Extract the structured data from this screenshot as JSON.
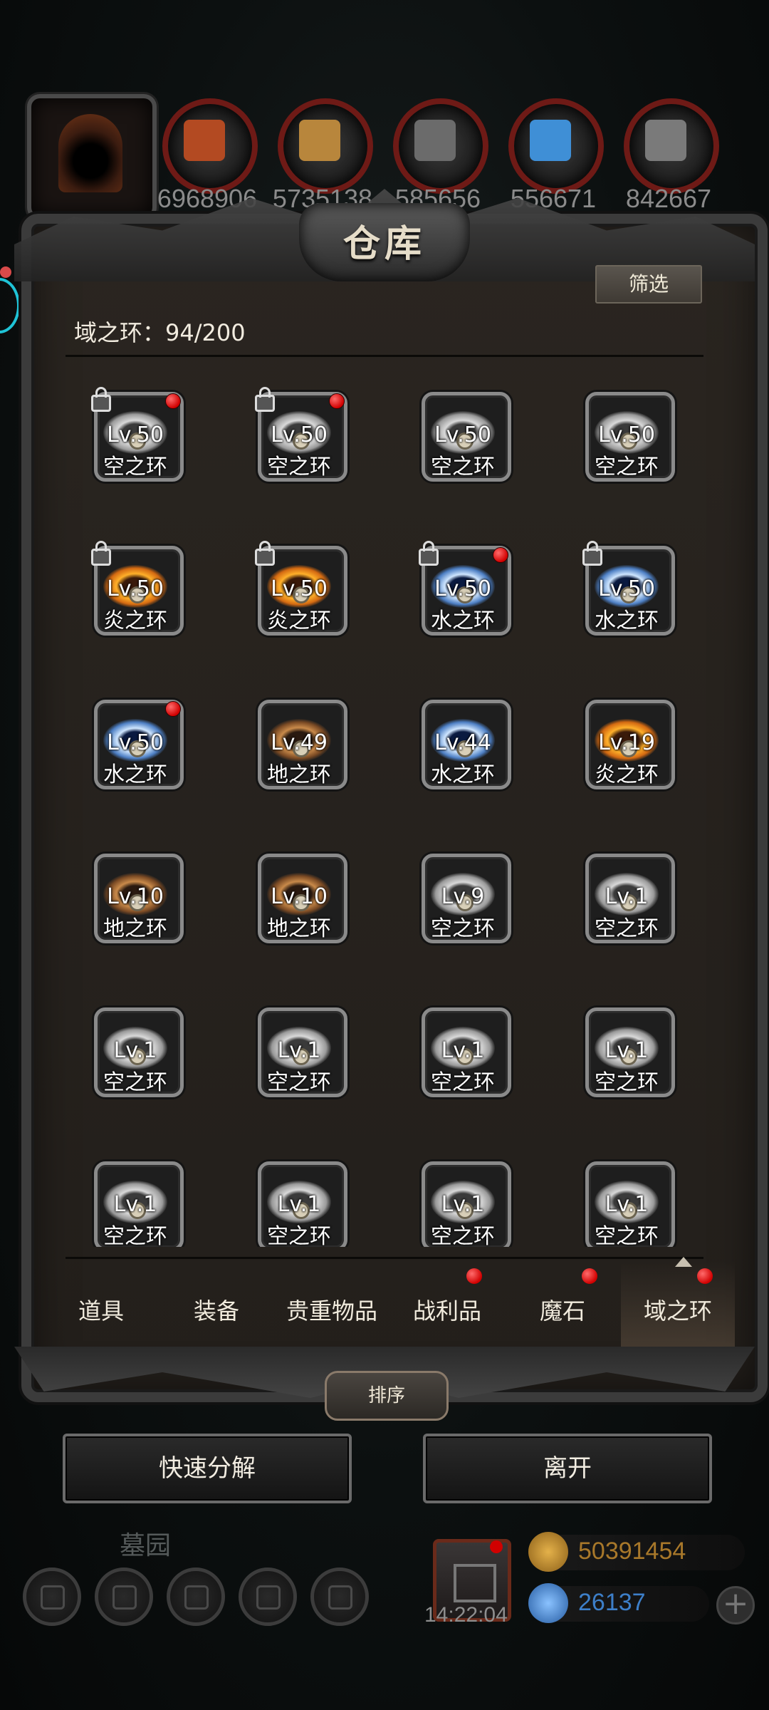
{
  "resources": [
    {
      "value": "6968906",
      "icon": "meat-icon",
      "color": "#b34a22"
    },
    {
      "value": "5735138",
      "icon": "wood-icon",
      "color": "#b8863c"
    },
    {
      "value": "585656",
      "icon": "stone-icon",
      "color": "#6b6b6b"
    },
    {
      "value": "556671",
      "icon": "crystal-icon",
      "color": "#3f8fd6"
    },
    {
      "value": "842667",
      "icon": "iron-icon",
      "color": "#7a7a7a"
    }
  ],
  "panel": {
    "title": "仓库",
    "filter_label": "筛选",
    "capacity": "域之环：94/200"
  },
  "items": [
    {
      "lv": "Lv.50",
      "name": "空之环",
      "element": "air",
      "locked": true,
      "new": true
    },
    {
      "lv": "Lv.50",
      "name": "空之环",
      "element": "air",
      "locked": true,
      "new": true
    },
    {
      "lv": "Lv.50",
      "name": "空之环",
      "element": "air",
      "locked": false,
      "new": false
    },
    {
      "lv": "Lv.50",
      "name": "空之环",
      "element": "air",
      "locked": false,
      "new": false
    },
    {
      "lv": "Lv.50",
      "name": "炎之环",
      "element": "fire",
      "locked": true,
      "new": false
    },
    {
      "lv": "Lv.50",
      "name": "炎之环",
      "element": "fire",
      "locked": true,
      "new": false
    },
    {
      "lv": "Lv.50",
      "name": "水之环",
      "element": "water",
      "locked": true,
      "new": true
    },
    {
      "lv": "Lv.50",
      "name": "水之环",
      "element": "water",
      "locked": true,
      "new": false
    },
    {
      "lv": "Lv.50",
      "name": "水之环",
      "element": "water",
      "locked": false,
      "new": true
    },
    {
      "lv": "Lv.49",
      "name": "地之环",
      "element": "earth",
      "locked": false,
      "new": false
    },
    {
      "lv": "Lv.44",
      "name": "水之环",
      "element": "water",
      "locked": false,
      "new": false
    },
    {
      "lv": "Lv.19",
      "name": "炎之环",
      "element": "fire",
      "locked": false,
      "new": false
    },
    {
      "lv": "Lv.10",
      "name": "地之环",
      "element": "earth",
      "locked": false,
      "new": false
    },
    {
      "lv": "Lv.10",
      "name": "地之环",
      "element": "earth",
      "locked": false,
      "new": false
    },
    {
      "lv": "Lv.9",
      "name": "空之环",
      "element": "air",
      "locked": false,
      "new": false
    },
    {
      "lv": "Lv.1",
      "name": "空之环",
      "element": "air",
      "locked": false,
      "new": false
    },
    {
      "lv": "Lv.1",
      "name": "空之环",
      "element": "air",
      "locked": false,
      "new": false
    },
    {
      "lv": "Lv.1",
      "name": "空之环",
      "element": "air",
      "locked": false,
      "new": false
    },
    {
      "lv": "Lv.1",
      "name": "空之环",
      "element": "air",
      "locked": false,
      "new": false
    },
    {
      "lv": "Lv.1",
      "name": "空之环",
      "element": "air",
      "locked": false,
      "new": false
    },
    {
      "lv": "Lv.1",
      "name": "空之环",
      "element": "air",
      "locked": false,
      "new": false
    },
    {
      "lv": "Lv.1",
      "name": "空之环",
      "element": "air",
      "locked": false,
      "new": false
    },
    {
      "lv": "Lv.1",
      "name": "空之环",
      "element": "air",
      "locked": false,
      "new": false
    },
    {
      "lv": "Lv.1",
      "name": "空之环",
      "element": "air",
      "locked": false,
      "new": false
    }
  ],
  "tabs": [
    {
      "label": "道具",
      "dot": false,
      "active": false
    },
    {
      "label": "装备",
      "dot": false,
      "active": false
    },
    {
      "label": "贵重物品",
      "dot": false,
      "active": false
    },
    {
      "label": "战利品",
      "dot": true,
      "active": false
    },
    {
      "label": "魔石",
      "dot": true,
      "active": false
    },
    {
      "label": "域之环",
      "dot": true,
      "active": true
    }
  ],
  "sort_label": "排序",
  "actions": {
    "decompose": "快速分解",
    "leave": "离开"
  },
  "hud": {
    "location": "墓园",
    "timer": "14:22:04",
    "gold": "50391454",
    "gems": "26137",
    "colors": {
      "gold": "#c2912e",
      "gems": "#3d7fc9"
    }
  }
}
